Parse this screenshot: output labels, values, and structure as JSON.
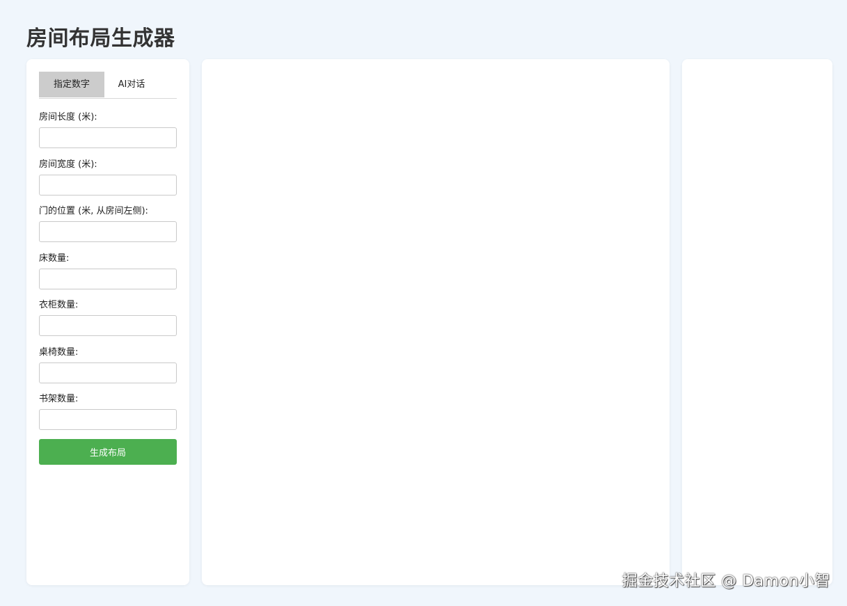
{
  "app": {
    "title": "房间布局生成器"
  },
  "tabs": [
    {
      "label": "指定数字",
      "active": true
    },
    {
      "label": "AI对话",
      "active": false
    }
  ],
  "form": {
    "fields": [
      {
        "label": "房间长度 (米):",
        "value": "",
        "placeholder": ""
      },
      {
        "label": "房间宽度 (米):",
        "value": "",
        "placeholder": ""
      },
      {
        "label": "门的位置 (米, 从房间左侧):",
        "value": "",
        "placeholder": ""
      },
      {
        "label": "床数量:",
        "value": "",
        "placeholder": ""
      },
      {
        "label": "衣柜数量:",
        "value": "",
        "placeholder": ""
      },
      {
        "label": "桌椅数量:",
        "value": "",
        "placeholder": ""
      },
      {
        "label": "书架数量:",
        "value": "",
        "placeholder": ""
      }
    ],
    "submit_label": "生成布局"
  },
  "watermark": "掘金技术社区 @ Damon小智",
  "colors": {
    "background": "#f0f6fc",
    "panel": "#ffffff",
    "active_tab": "#cccccc",
    "button": "#4caf50"
  }
}
